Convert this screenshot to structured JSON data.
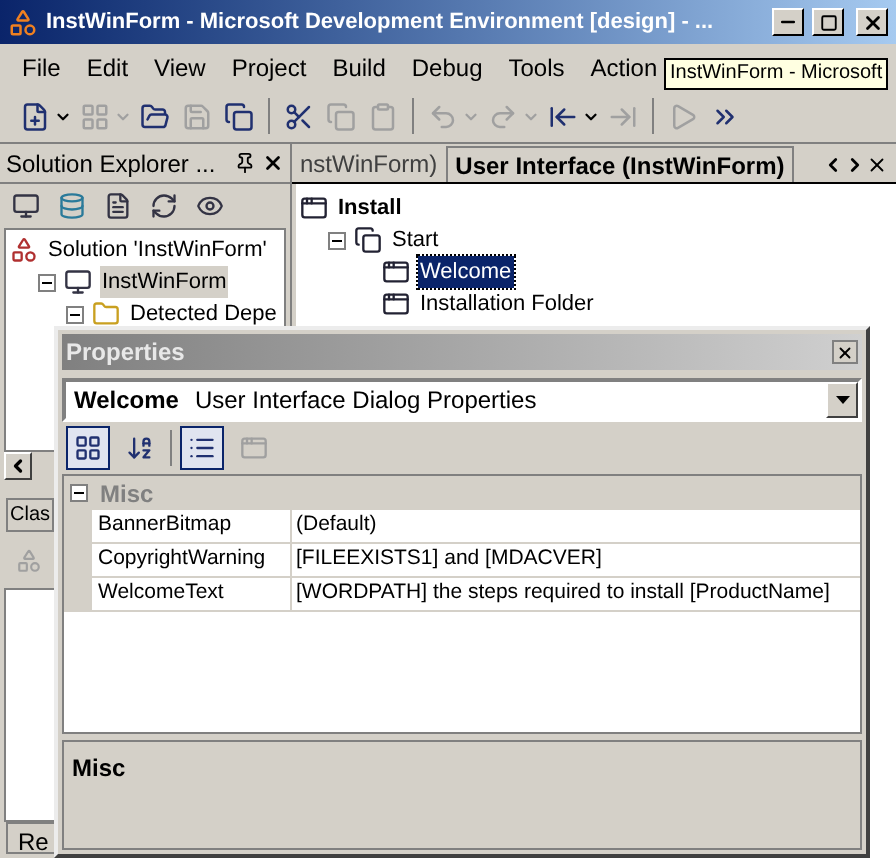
{
  "window": {
    "title": "InstWinForm - Microsoft Development Environment [design] - ..."
  },
  "menu": [
    "File",
    "Edit",
    "View",
    "Project",
    "Build",
    "Debug",
    "Tools",
    "Action"
  ],
  "tooltip": "InstWinForm - Microsoft",
  "toolbar": [
    {
      "kind": "new",
      "disabled": false,
      "dropdown": true
    },
    {
      "kind": "add",
      "disabled": true,
      "dropdown": true
    },
    {
      "kind": "open",
      "disabled": false
    },
    {
      "kind": "save",
      "disabled": true
    },
    {
      "kind": "saveall",
      "disabled": false
    },
    {
      "kind": "sep"
    },
    {
      "kind": "cut",
      "disabled": false
    },
    {
      "kind": "copy",
      "disabled": true
    },
    {
      "kind": "paste",
      "disabled": true
    },
    {
      "kind": "sep"
    },
    {
      "kind": "undo",
      "disabled": true,
      "dropdown": true
    },
    {
      "kind": "redo",
      "disabled": true,
      "dropdown": true
    },
    {
      "kind": "back",
      "disabled": false,
      "dropdown": true
    },
    {
      "kind": "forward",
      "disabled": true
    },
    {
      "kind": "sep"
    },
    {
      "kind": "start",
      "disabled": true
    },
    {
      "kind": "more",
      "disabled": false
    }
  ],
  "solution_explorer": {
    "title": "Solution Explorer ...",
    "tree": [
      {
        "label": "Solution 'InstWinForm'",
        "kind": "solution",
        "selected": false,
        "children": [
          {
            "label": "InstWinForm",
            "kind": "project",
            "selected": true,
            "expanded": true,
            "children": [
              {
                "label": "Detected Depe",
                "kind": "folder",
                "selected": false,
                "expanded": true
              }
            ]
          }
        ]
      }
    ],
    "tabs": [
      {
        "label": "Clas"
      }
    ],
    "bottom_tab": "Re"
  },
  "document_tabs": [
    {
      "label": "nstWinForm)",
      "selected": false
    },
    {
      "label": "User Interface (InstWinForm)",
      "selected": true
    }
  ],
  "ui_tree": [
    {
      "label": "Install",
      "kind": "root",
      "selected": false,
      "children": [
        {
          "label": "Start",
          "kind": "group",
          "selected": false,
          "expanded": true,
          "children": [
            {
              "label": "Welcome",
              "kind": "dialog",
              "selected": true
            },
            {
              "label": "Installation Folder",
              "kind": "dialog",
              "selected": false
            }
          ]
        }
      ]
    }
  ],
  "properties": {
    "title": "Properties",
    "object_name": "Welcome",
    "object_type": "User Interface Dialog Properties",
    "toolbar": [
      {
        "kind": "categorized",
        "pressed": true,
        "disabled": false
      },
      {
        "kind": "alphabetical",
        "pressed": false,
        "disabled": false
      },
      {
        "kind": "sep"
      },
      {
        "kind": "properties",
        "pressed": true,
        "disabled": false
      },
      {
        "kind": "pages",
        "pressed": false,
        "disabled": true
      }
    ],
    "category": {
      "name": "Misc",
      "expanded": true
    },
    "rows": [
      {
        "name": "BannerBitmap",
        "value": "(Default)"
      },
      {
        "name": "CopyrightWarning",
        "value": "[FILEEXISTS1] and [MDACVER]"
      },
      {
        "name": "WelcomeText",
        "value": "[WORDPATH] the steps required to install [ProductName]"
      }
    ],
    "description_title": "Misc"
  }
}
